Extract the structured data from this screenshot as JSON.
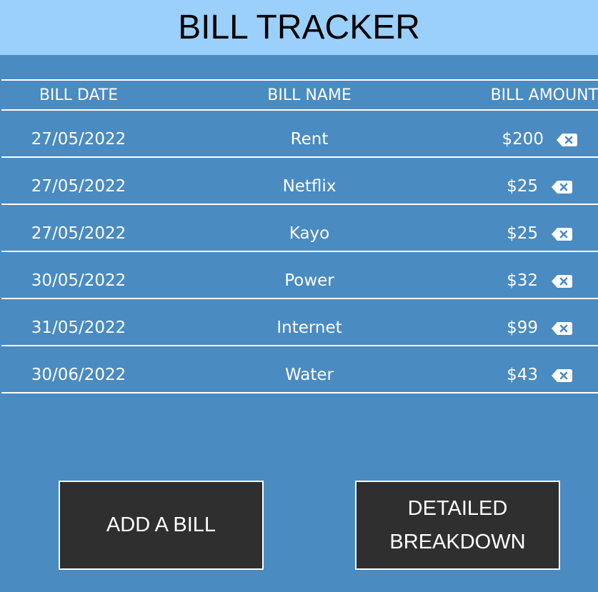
{
  "header": {
    "title": "BILL TRACKER"
  },
  "table": {
    "columns": {
      "date": "BILL DATE",
      "name": "BILL NAME",
      "amount": "BILL AMOUNT"
    },
    "rows": [
      {
        "date": "27/05/2022",
        "name": "Rent",
        "amount": "$200"
      },
      {
        "date": "27/05/2022",
        "name": "Netflix",
        "amount": "$25"
      },
      {
        "date": "27/05/2022",
        "name": "Kayo",
        "amount": "$25"
      },
      {
        "date": "30/05/2022",
        "name": "Power",
        "amount": "$32"
      },
      {
        "date": "31/05/2022",
        "name": "Internet",
        "amount": "$99"
      },
      {
        "date": "30/06/2022",
        "name": "Water",
        "amount": "$43"
      }
    ],
    "delete_icon": "backspace-delete-icon"
  },
  "buttons": {
    "add_label": "ADD A BILL",
    "detail_label": "DETAILED BREAKDOWN"
  },
  "colors": {
    "background": "#4a8bc1",
    "header": "#9bd0fd",
    "button": "#2f2f2f",
    "text": "#ffffff"
  }
}
